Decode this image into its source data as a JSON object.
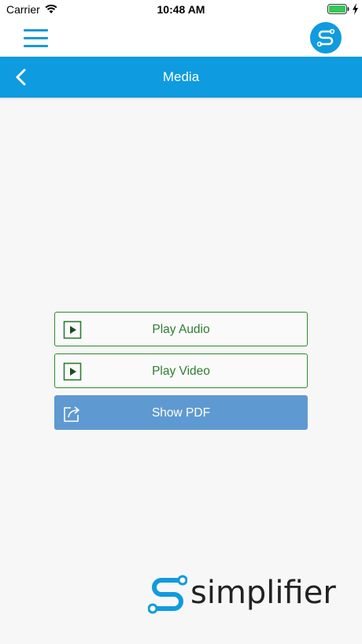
{
  "status_bar": {
    "carrier": "Carrier",
    "time": "10:48 AM",
    "icons": [
      "wifi-icon",
      "battery-icon",
      "charging-bolt-icon"
    ]
  },
  "top_bar": {
    "menu_icon": "hamburger-menu-icon",
    "logo_icon": "simplifier-s-logo-icon",
    "accent_color": "#159ad8"
  },
  "nav_bar": {
    "title": "Media",
    "back_icon": "chevron-left-icon",
    "background_color": "#0e9be0"
  },
  "actions": [
    {
      "label": "Play Audio",
      "icon": "play-icon",
      "style": "outline",
      "color": "#2e7d32"
    },
    {
      "label": "Play Video",
      "icon": "play-icon",
      "style": "outline",
      "color": "#2e7d32"
    },
    {
      "label": "Show PDF",
      "icon": "share-icon",
      "style": "filled",
      "color": "#5e99d1"
    }
  ],
  "footer": {
    "brand_name": "simplifier",
    "brand_icon": "simplifier-s-logo-icon"
  }
}
